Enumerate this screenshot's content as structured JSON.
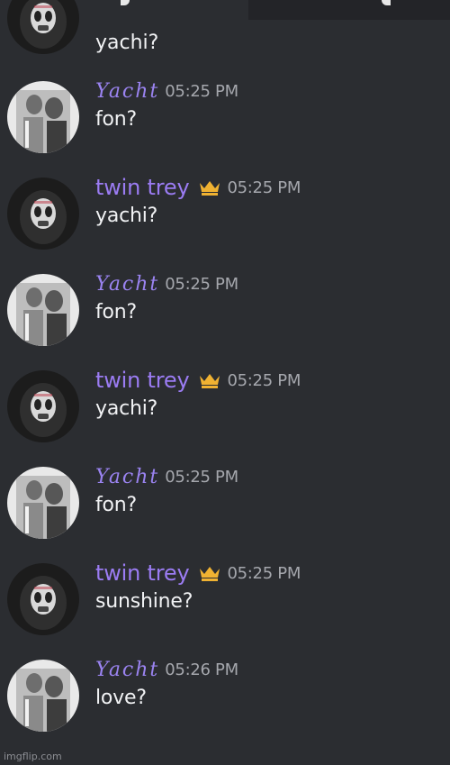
{
  "users": {
    "yacht": {
      "name": "Yacht",
      "name_color": "#9a83f0",
      "avatar": "grayscale-figure-avatar"
    },
    "twin_trey": {
      "name": "twin trey",
      "name_color": "#9b7cf3",
      "badge": "crown-icon",
      "badge_color": "#f0b232",
      "avatar": "dark-masked-figure-avatar"
    }
  },
  "messages": [
    {
      "author": "twin trey",
      "time": "",
      "text": "yachi?"
    },
    {
      "author": "Yacht",
      "time": "05:25 PM",
      "text": "fon?"
    },
    {
      "author": "twin trey",
      "time": "05:25 PM",
      "text": "yachi?"
    },
    {
      "author": "Yacht",
      "time": "05:25 PM",
      "text": "fon?"
    },
    {
      "author": "twin trey",
      "time": "05:25 PM",
      "text": "yachi?"
    },
    {
      "author": "Yacht",
      "time": "05:25 PM",
      "text": "fon?"
    },
    {
      "author": "twin trey",
      "time": "05:25 PM",
      "text": "sunshine?"
    },
    {
      "author": "Yacht",
      "time": "05:26 PM",
      "text": "love?"
    }
  ],
  "watermark": "imgflip.com"
}
